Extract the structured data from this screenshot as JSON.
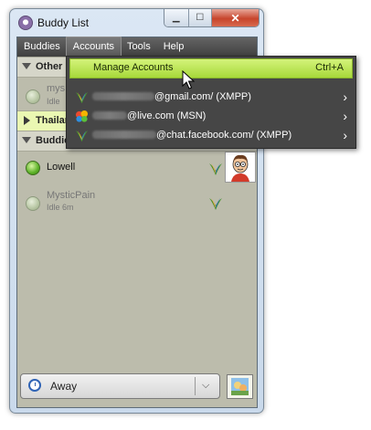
{
  "window": {
    "title": "Buddy List"
  },
  "menu": {
    "items": [
      "Buddies",
      "Accounts",
      "Tools",
      "Help"
    ]
  },
  "groups": [
    {
      "name": "Other"
    },
    {
      "name": "Thailan"
    },
    {
      "name": "Buddie"
    }
  ],
  "other_buddy": {
    "name": "mys",
    "status": "Idle"
  },
  "buddies": [
    {
      "name": "Lowell",
      "status": ""
    },
    {
      "name": "MysticPain",
      "status": "Idle 6m"
    }
  ],
  "status_selector": {
    "label": "Away"
  },
  "accounts_menu": {
    "manage": {
      "label": "Manage Accounts",
      "shortcut": "Ctrl+A"
    },
    "accounts": [
      {
        "label": "@gmail.com/ (XMPP)",
        "icon": "xmpp-icon"
      },
      {
        "label": "@live.com (MSN)",
        "icon": "msn-butterfly-icon"
      },
      {
        "label": "@chat.facebook.com/ (XMPP)",
        "icon": "xmpp-icon"
      }
    ]
  },
  "colors": {
    "highlight": "#b8e64a",
    "menubar": "#4a4a4a",
    "list_bg": "#bcbcac"
  }
}
